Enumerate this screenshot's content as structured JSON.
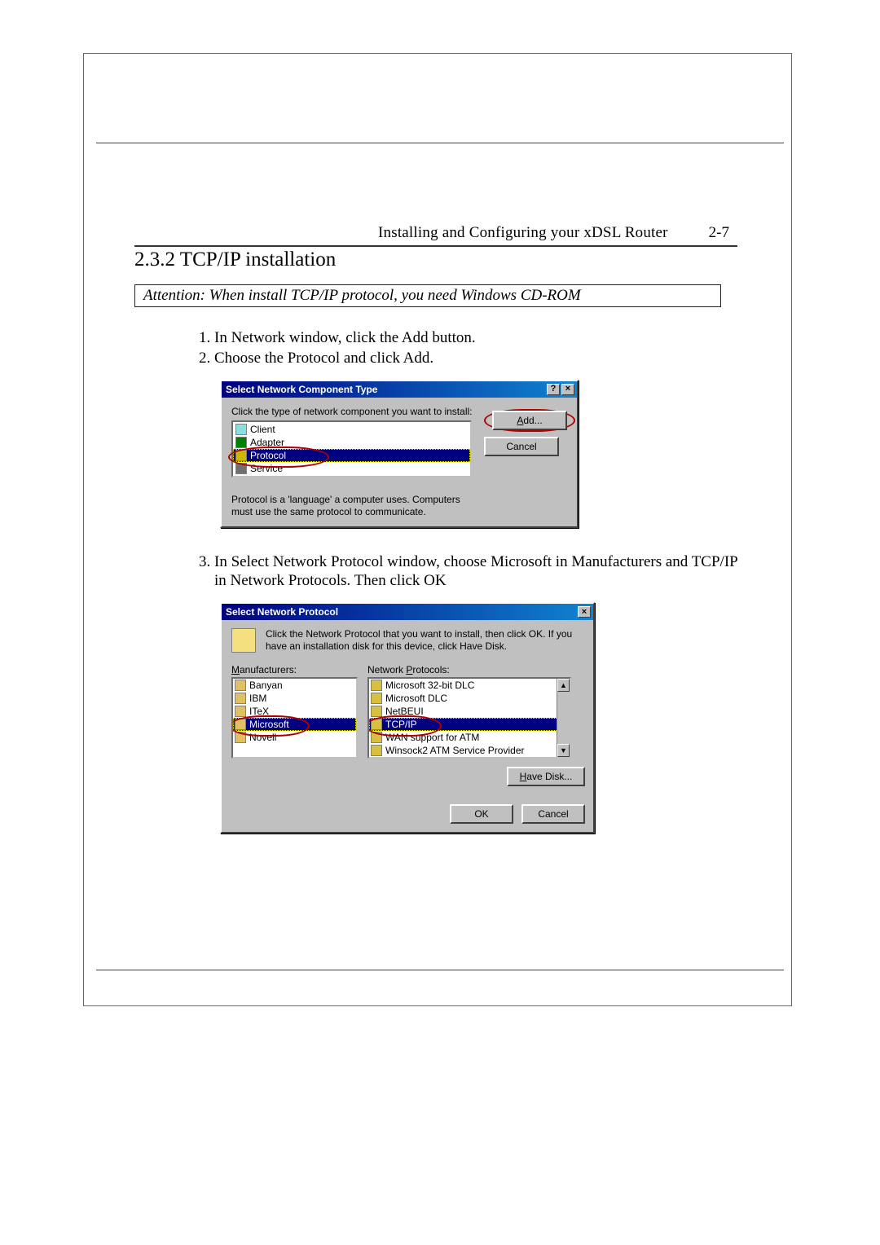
{
  "page": {
    "chapter_title": "Installing and Configuring your xDSL Router",
    "page_number": "2-7",
    "section_number_title": "2.3.2 TCP/IP installation",
    "attention": "Attention: When install TCP/IP protocol, you need Windows CD-ROM"
  },
  "steps": {
    "s1_num": "1.",
    "s1": "In Network window, click the Add button.",
    "s2_num": "2.",
    "s2": "Choose the Protocol and click Add.",
    "s3_num": "3.",
    "s3": "In Select Network Protocol window, choose Microsoft in Manufacturers and TCP/IP in Network Protocols. Then click OK"
  },
  "dialog1": {
    "title": "Select Network Component Type",
    "help_btn": "?",
    "close_btn": "×",
    "instruction": "Click the type of network component you want to install:",
    "items": {
      "client": "Client",
      "adapter": "Adapter",
      "protocol": "Protocol",
      "service": "Service"
    },
    "add_btn_u": "A",
    "add_btn_rest": "dd...",
    "cancel_btn": "Cancel",
    "desc": "Protocol is a 'language' a computer uses. Computers must use the same protocol to communicate."
  },
  "dialog2": {
    "title": "Select Network Protocol",
    "close_btn": "×",
    "instruction": "Click the Network Protocol that you want to install, then click OK. If you have an installation disk for this device, click Have Disk.",
    "mfg_label_u": "M",
    "mfg_label_rest": "anufacturers:",
    "proto_label": "Network ",
    "proto_label_u": "P",
    "proto_label_rest": "rotocols:",
    "manufacturers": {
      "banyan": "Banyan",
      "ibm": "IBM",
      "itex": "ITeX",
      "microsoft": "Microsoft",
      "novell": "Novell"
    },
    "protocols": {
      "dlc32": "Microsoft 32-bit DLC",
      "dlc": "Microsoft DLC",
      "netbeui": "NetBEUI",
      "tcpip": "TCP/IP",
      "wanatm": "WAN support for ATM",
      "winsock": "Winsock2 ATM Service Provider"
    },
    "have_disk_u": "H",
    "have_disk_rest": "ave Disk...",
    "ok_btn": "OK",
    "cancel_btn": "Cancel",
    "scroll_up": "▲",
    "scroll_down": "▼"
  }
}
